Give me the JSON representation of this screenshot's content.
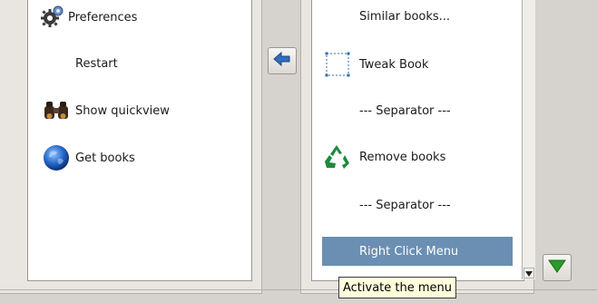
{
  "left_list": {
    "items": [
      {
        "label": "Preferences",
        "icon": "gear-icon"
      },
      {
        "label": "Restart",
        "icon": ""
      },
      {
        "label": "Show quickview",
        "icon": "binoculars-icon"
      },
      {
        "label": "Get books",
        "icon": "globe-icon"
      }
    ]
  },
  "right_list": {
    "items": [
      {
        "label": "Similar books...",
        "icon": ""
      },
      {
        "label": "Tweak Book",
        "icon": "tweak-selection-icon"
      },
      {
        "label": "--- Separator ---",
        "icon": ""
      },
      {
        "label": "Remove books",
        "icon": "recycle-icon"
      },
      {
        "label": "--- Separator ---",
        "icon": ""
      },
      {
        "label": "Right Click Menu",
        "icon": "",
        "selected": true
      }
    ]
  },
  "buttons": {
    "move_left": "left-arrow-icon",
    "move_down": "down-arrow-icon"
  },
  "tooltip": {
    "text": "Activate the menu"
  },
  "colors": {
    "selection": "#6a8fb2",
    "tooltip_bg": "#ffffdc",
    "arrow_blue": "#2f6fb8",
    "arrow_green": "#2a9a2a",
    "recycle_green": "#1d8a3c"
  }
}
